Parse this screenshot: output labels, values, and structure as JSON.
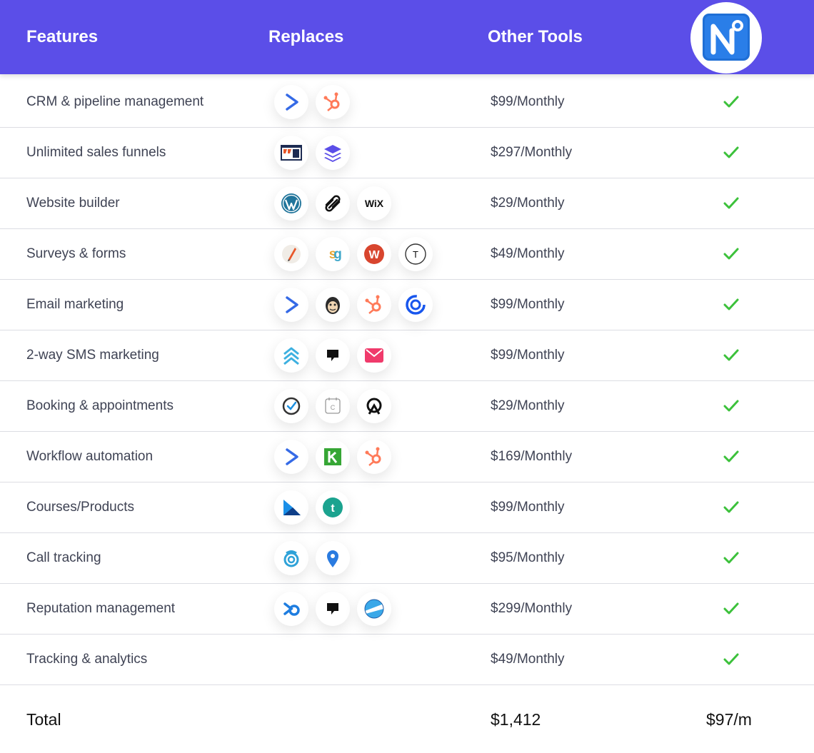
{
  "header": {
    "features": "Features",
    "replaces": "Replaces",
    "other_tools": "Other Tools",
    "logo": "brand-logo-icon",
    "accent_color": "#5b4ee8"
  },
  "rows": [
    {
      "feature": "CRM & pipeline management",
      "price": "$99/Monthly",
      "icons": [
        "activecampaign-icon",
        "hubspot-icon"
      ]
    },
    {
      "feature": "Unlimited sales funnels",
      "price": "$297/Monthly",
      "icons": [
        "clickfunnels-icon",
        "leadpages-icon"
      ]
    },
    {
      "feature": "Website builder",
      "price": "$29/Monthly",
      "icons": [
        "wordpress-icon",
        "squarespace-icon",
        "wix-icon"
      ]
    },
    {
      "feature": "Surveys & forms",
      "price": "$49/Monthly",
      "icons": [
        "formstack-icon",
        "surveygizmo-icon",
        "wufoo-icon",
        "typeform-icon"
      ]
    },
    {
      "feature": "Email marketing",
      "price": "$99/Monthly",
      "icons": [
        "activecampaign-icon",
        "mailchimp-icon",
        "hubspot-icon",
        "constant-contact-icon"
      ]
    },
    {
      "feature": "2-way SMS marketing",
      "price": "$99/Monthly",
      "icons": [
        "stacks-icon",
        "podium-icon",
        "mail-icon"
      ]
    },
    {
      "feature": "Booking & appointments",
      "price": "$29/Monthly",
      "icons": [
        "checkmark-clock-icon",
        "calendly-icon",
        "acuity-icon"
      ]
    },
    {
      "feature": "Workflow automation",
      "price": "$169/Monthly",
      "icons": [
        "activecampaign-icon",
        "keap-icon",
        "hubspot-icon"
      ]
    },
    {
      "feature": "Courses/Products",
      "price": "$99/Monthly",
      "icons": [
        "kajabi-icon",
        "teachable-icon"
      ]
    },
    {
      "feature": "Call tracking",
      "price": "$95/Monthly",
      "icons": [
        "callrail-icon",
        "phone-pin-icon"
      ]
    },
    {
      "feature": "Reputation management",
      "price": "$299/Monthly",
      "icons": [
        "birdeye-icon",
        "podium-icon",
        "yext-icon"
      ]
    },
    {
      "feature": "Tracking & analytics",
      "price": "$49/Monthly",
      "icons": []
    }
  ],
  "checkmark_icon": "checkmark-icon",
  "check_color": "#3cc13b",
  "total": {
    "label": "Total",
    "other_tools": "$1,412",
    "ours": "$97/m"
  }
}
